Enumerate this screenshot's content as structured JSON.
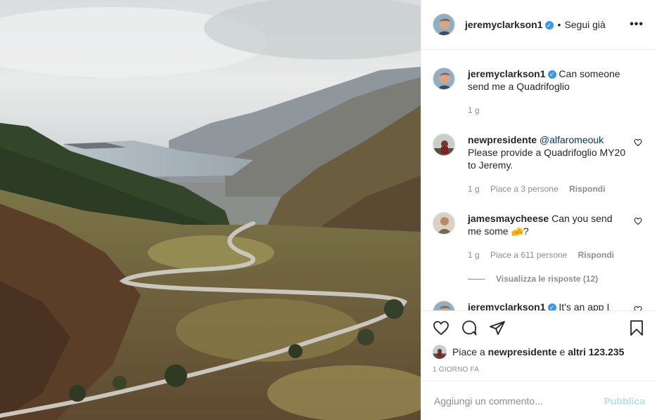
{
  "header": {
    "username": "jeremyclarkson1",
    "verified": true,
    "separator": "•",
    "follow_status": "Segui già",
    "more_icon": "ellipsis-icon"
  },
  "caption": {
    "username": "jeremyclarkson1",
    "text": "Can someone send me a Quadrifoglio",
    "time": "1 g"
  },
  "comments": [
    {
      "username": "newpresidente",
      "mention": "@alfaromeouk",
      "text": "Please provide a Quadrifoglio MY20 to Jeremy.",
      "time": "1 g",
      "likes": "Piace a 3 persone",
      "reply_label": "Rispondi"
    },
    {
      "username": "jamesmaycheese",
      "text_before": "Can you send me some",
      "emoji": "🧀",
      "text_after": "?",
      "time": "1 g",
      "likes": "Piace a 611 persone",
      "reply_label": "Rispondi",
      "view_replies": "Visualizza le risposte (12)"
    },
    {
      "username": "jeremyclarkson1",
      "verified": true,
      "text": "It's an app I have"
    }
  ],
  "actions": {
    "like_icon": "heart-icon",
    "comment_icon": "comment-icon",
    "share_icon": "paper-plane-icon",
    "save_icon": "bookmark-icon"
  },
  "likes": {
    "prefix": "Piace a",
    "user": "newpresidente",
    "connector": "e",
    "others": "altri 123.235"
  },
  "timestamp": "1 GIORNO FA",
  "add_comment": {
    "placeholder": "Aggiungi un commento...",
    "publish_label": "Pubblica"
  },
  "colors": {
    "link_blue": "#00376b",
    "verified_blue": "#3897f0",
    "publish_disabled": "#b2dffc",
    "secondary_text": "#8e8e8e"
  }
}
